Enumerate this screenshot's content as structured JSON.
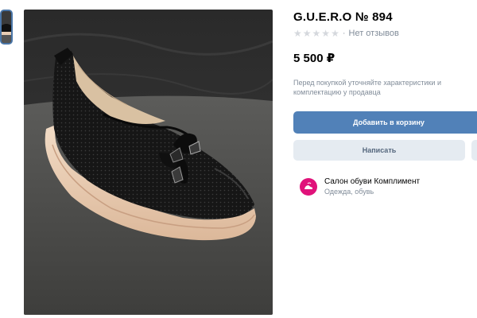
{
  "product": {
    "title": "G.U.E.R.O № 894",
    "rating_stars": 5,
    "rating_filled": 0,
    "reviews_label": "Нет отзывов",
    "price": "5 500 ₽",
    "notice": "Перед покупкой уточняйте характеристики и комплектацию у продавца"
  },
  "actions": {
    "add_to_cart_label": "Добавить в корзину",
    "message_label": "Написать"
  },
  "seller": {
    "name": "Салон обуви Комплимент",
    "category": "Одежда, обувь"
  },
  "colors": {
    "accent": "#5181b8",
    "secondary_bg": "#e5ebf1",
    "muted_text": "#818c99",
    "avatar_bg": "#e0127a"
  },
  "icons": {
    "star": "star-icon",
    "more": "more-icon",
    "avatar": "shoe-logo-icon"
  }
}
